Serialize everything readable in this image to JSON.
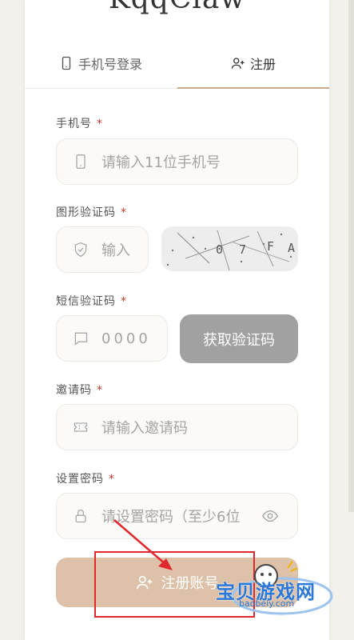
{
  "app": {
    "title": "KqqClaw"
  },
  "tabs": {
    "login_label": "手机号登录",
    "register_label": "注册"
  },
  "form": {
    "phone": {
      "label": "手机号",
      "required_mark": "*",
      "placeholder": "请输入11位手机号"
    },
    "captcha": {
      "label": "图形验证码",
      "required_mark": "*",
      "placeholder": "输入",
      "image_chars": [
        "0",
        "7",
        "F",
        "A"
      ]
    },
    "sms": {
      "label": "短信验证码",
      "required_mark": "*",
      "placeholder": "0000",
      "get_code_label": "获取验证码"
    },
    "invite": {
      "label": "邀请码",
      "required_mark": "*",
      "placeholder": "请输入邀请码"
    },
    "password": {
      "label": "设置密码",
      "required_mark": "*",
      "placeholder": "请设置密码（至少6位"
    }
  },
  "submit": {
    "label": "注册账号"
  },
  "watermark": {
    "text": "宝贝游戏网",
    "url": "baobeiy.com"
  },
  "colors": {
    "accent": "#c9a98a",
    "submit_bg": "#ddc1a8",
    "annotation": "#e0282d",
    "required": "#c0392b"
  }
}
